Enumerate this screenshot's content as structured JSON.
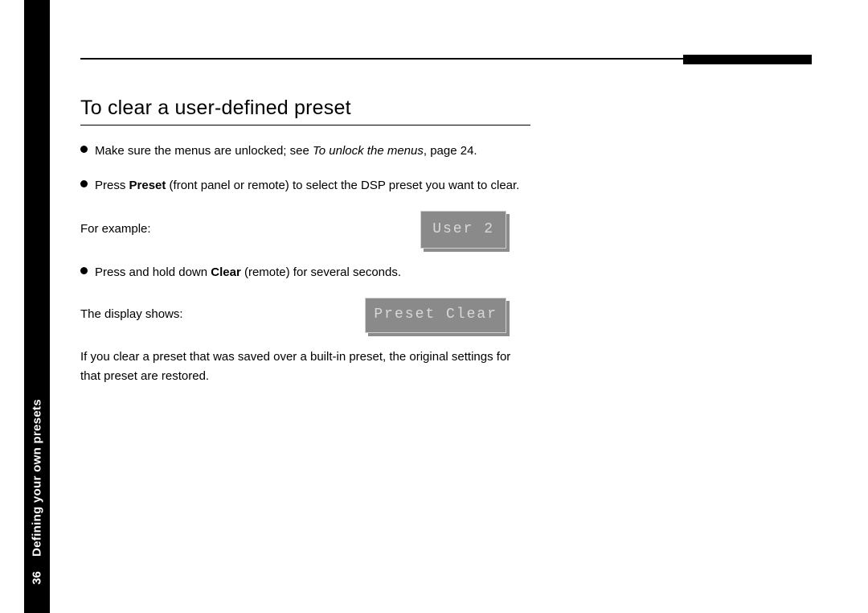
{
  "sidebar": {
    "section_title": "Defining your own presets",
    "page_number": "36"
  },
  "heading": "To clear a user-defined preset",
  "bullets": {
    "b1_pre": "Make sure the menus are unlocked; see ",
    "b1_ital": "To unlock the menus",
    "b1_post": ", page 24.",
    "b2_pre": "Press ",
    "b2_bold": "Preset",
    "b2_post": " (front panel or remote) to select the DSP preset you want to clear.",
    "b3_pre": "Press and hold down ",
    "b3_bold": "Clear",
    "b3_post": " (remote) for several seconds."
  },
  "labels": {
    "for_example": "For example:",
    "display_shows": "The display shows:"
  },
  "lcd": {
    "user": "User 2",
    "preset_clear": "Preset Clear"
  },
  "closing": "If you clear a preset that was saved over a built-in preset, the original settings for that preset are restored."
}
